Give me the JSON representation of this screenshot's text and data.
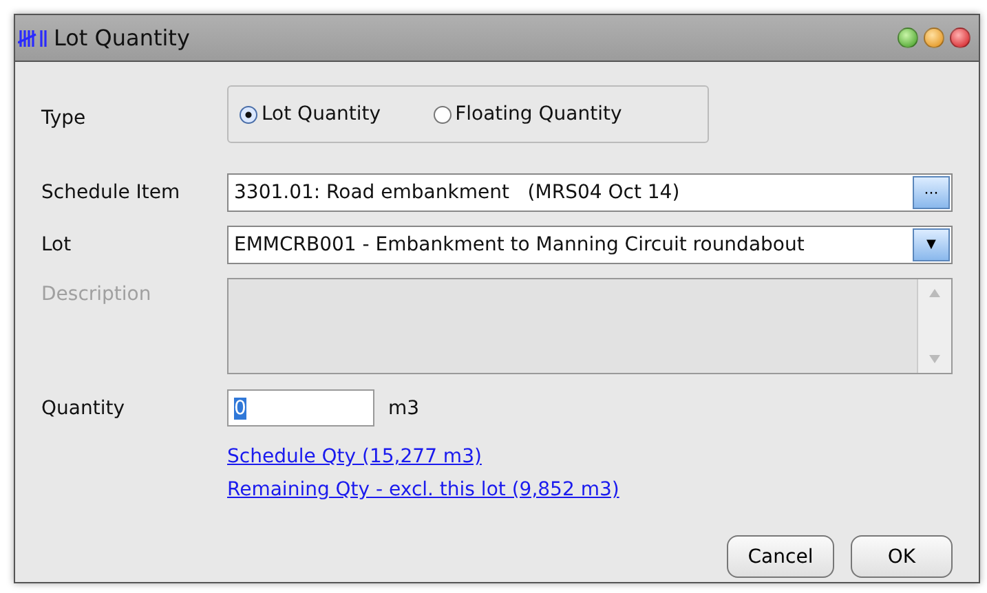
{
  "window": {
    "title": "Lot Quantity"
  },
  "type": {
    "label": "Type",
    "options": [
      {
        "label": "Lot Quantity",
        "selected": true
      },
      {
        "label": "Floating Quantity",
        "selected": false
      }
    ]
  },
  "schedule_item": {
    "label": "Schedule Item",
    "value": "3301.01: Road embankment   (MRS04 Oct 14)",
    "button": "···"
  },
  "lot": {
    "label": "Lot",
    "value": "EMMCRB001 - Embankment to Manning Circuit roundabout",
    "button": "▼"
  },
  "description": {
    "label": "Description",
    "disabled": true
  },
  "quantity": {
    "label": "Quantity",
    "value": "0",
    "unit": "m3"
  },
  "links": [
    "Schedule Qty (15,277 m3)",
    "Remaining Qty - excl. this lot (9,852 m3)"
  ],
  "buttons": [
    "Cancel",
    "OK"
  ]
}
